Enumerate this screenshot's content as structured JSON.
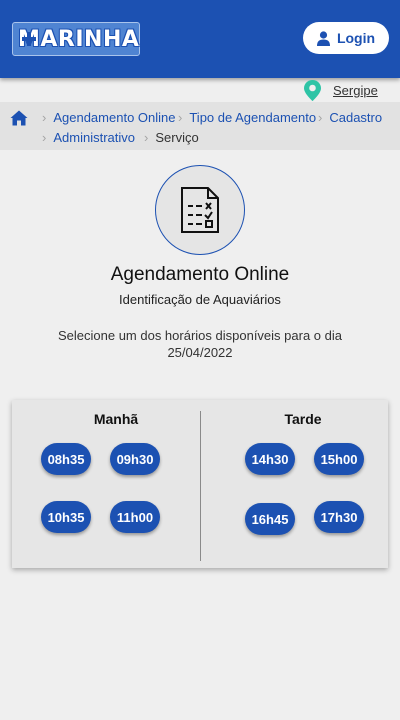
{
  "header": {
    "logo_text": "MARINHA",
    "login_label": "Login"
  },
  "location": {
    "state": "Sergipe"
  },
  "breadcrumb": {
    "items": [
      "Agendamento Online",
      "Tipo de Agendamento",
      "Cadastro",
      "Administrativo"
    ],
    "current": "Serviço"
  },
  "main": {
    "title": "Agendamento Online",
    "subtitle": "Identificação de Aquaviários",
    "instruction": "Selecione um dos horários disponíveis para o dia",
    "date": "25/04/2022"
  },
  "schedule": {
    "morning": {
      "label": "Manhã",
      "slots": [
        "08h35",
        "09h30",
        "10h35",
        "11h00"
      ]
    },
    "afternoon": {
      "label": "Tarde",
      "slots": [
        "14h30",
        "15h00",
        "16h45",
        "17h30"
      ]
    }
  },
  "colors": {
    "brand_blue": "#1c51b2",
    "location_pin": "#2ec4a6"
  }
}
